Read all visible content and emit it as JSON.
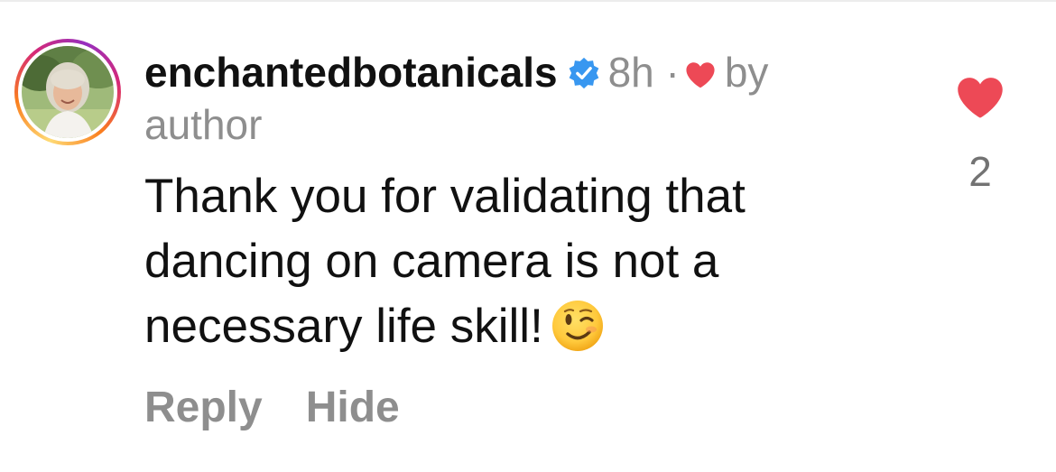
{
  "comment": {
    "username": "enchantedbotanicals",
    "timestamp": "8h",
    "separator": "·",
    "liked_by_label": "by",
    "liked_by_line2": "author",
    "text": "Thank you for validating that dancing on camera is not a necessary life skill!",
    "emoji_icon": "winking-face-emoji"
  },
  "actions": {
    "reply_label": "Reply",
    "hide_label": "Hide"
  },
  "like": {
    "count": "2",
    "heart_color": "#ed4956"
  },
  "colors": {
    "verified_badge": "#3897f0",
    "muted_text": "#8e8e8e",
    "primary_text": "#111111"
  }
}
